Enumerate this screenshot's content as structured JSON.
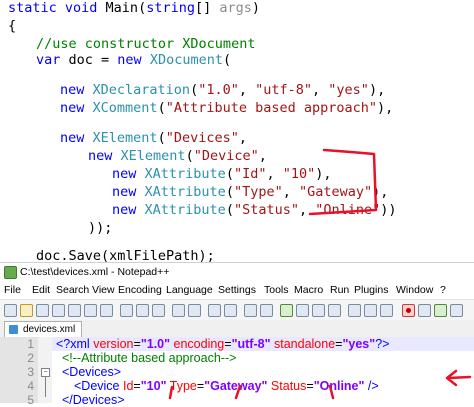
{
  "code": {
    "lines": [
      {
        "kw1": "static void ",
        "name": "Main",
        "p1": "(",
        "kw2": "string",
        "p2": "[] ",
        "gr": "args",
        "p3": ")"
      },
      {
        "text": "{"
      },
      {
        "cm": "//use constructor XDocument"
      },
      {
        "kw": "var",
        "rest1": " doc = ",
        "kw2": "new",
        "sp": " ",
        "ty": "XDocument",
        "rest2": "("
      },
      {
        "kw": "new",
        "sp": " ",
        "ty": "XDeclaration",
        "p1": "(",
        "s1": "\"1.0\"",
        "c1": ", ",
        "s2": "\"utf-8\"",
        "c2": ", ",
        "s3": "\"yes\"",
        "p2": "),"
      },
      {
        "kw": "new",
        "sp": " ",
        "ty": "XComment",
        "p1": "(",
        "s1": "\"Attribute based approach\"",
        "p2": "),"
      },
      {
        "kw": "new",
        "sp": " ",
        "ty": "XElement",
        "p1": "(",
        "s1": "\"Devices\"",
        "p2": ","
      },
      {
        "kw": "new",
        "sp": " ",
        "ty": "XElement",
        "p1": "(",
        "s1": "\"Device\"",
        "p2": ","
      },
      {
        "kw": "new",
        "sp": " ",
        "ty": "XAttribute",
        "p1": "(",
        "s1": "\"Id\"",
        "c1": ", ",
        "s2": "\"10\"",
        "p2": "),"
      },
      {
        "kw": "new",
        "sp": " ",
        "ty": "XAttribute",
        "p1": "(",
        "s1": "\"Type\"",
        "c1": ", ",
        "s2": "\"Gateway\"",
        "p2": "),"
      },
      {
        "kw": "new",
        "sp": " ",
        "ty": "XAttribute",
        "p1": "(",
        "s1": "\"Status\"",
        "c1": ", ",
        "s2": "\"Online\"",
        "p2": "))"
      },
      {
        "text": "));"
      },
      {
        "pre": "doc.Save(xmlFilePath);"
      },
      {
        "text": "}"
      }
    ]
  },
  "notepad": {
    "title": "C:\\test\\devices.xml - Notepad++",
    "menu": [
      "File",
      "Edit",
      "Search",
      "View",
      "Encoding",
      "Language",
      "Settings",
      "Tools",
      "Macro",
      "Run",
      "Plugins",
      "Window",
      "?"
    ],
    "tab_label": "devices.xml",
    "line_numbers": [
      "1",
      "2",
      "3",
      "4",
      "5"
    ],
    "xml": {
      "l1": {
        "open": "<?",
        "name": "xml",
        "a1": " version",
        "eq1": "=",
        "v1": "\"1.0\"",
        "a2": " encoding",
        "eq2": "=",
        "v2": "\"utf-8\"",
        "a3": " standalone",
        "eq3": "=",
        "v3": "\"yes\"",
        "close": "?>"
      },
      "l2": {
        "comment": "<!--Attribute based approach-->"
      },
      "l3": {
        "tag": "<Devices>"
      },
      "l4": {
        "open": "<Device",
        "a1": " Id",
        "eq1": "=",
        "v1": "\"10\"",
        "a2": " Type",
        "eq2": "=",
        "v2": "\"Gateway\"",
        "a3": " Status",
        "eq3": "=",
        "v3": "\"Online\"",
        "close": " />"
      },
      "l5": {
        "tag": "</Devices>"
      }
    }
  },
  "colors": {
    "annotation": "#e8102a",
    "keyword": "#0000ff",
    "type": "#2b91af",
    "string": "#a31515",
    "comment": "#008000"
  }
}
